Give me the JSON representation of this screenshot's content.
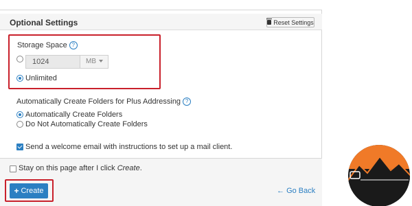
{
  "top_cut_text": "",
  "optional_settings": {
    "title": "Optional Settings",
    "reset_label": "Reset Settings"
  },
  "storage": {
    "label": "Storage Space",
    "help_icon": "help-circle-icon",
    "value": "1024",
    "unit": "MB",
    "unlimited_label": "Unlimited",
    "selected": "unlimited"
  },
  "plus_addressing": {
    "label": "Automatically Create Folders for Plus Addressing",
    "options": [
      "Automatically Create Folders",
      "Do Not Automatically Create Folders"
    ],
    "selected_index": 0
  },
  "welcome_email": {
    "label": "Send a welcome email with instructions to set up a mail client.",
    "checked": true
  },
  "stay_on_page": {
    "prefix": "Stay on this page after I click ",
    "italic": "Create",
    "suffix": ".",
    "checked": false
  },
  "actions": {
    "create_label": "Create",
    "goback_label": "Go Back"
  },
  "colors": {
    "accent": "#2b7fc2",
    "highlight": "#c9202b",
    "logo_orange": "#f07a28"
  }
}
